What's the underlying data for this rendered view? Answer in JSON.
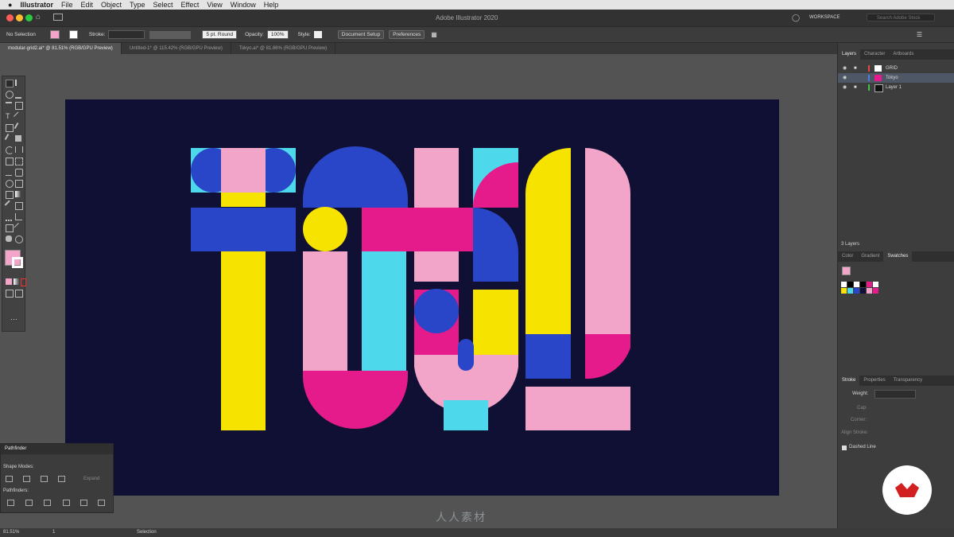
{
  "menubar": {
    "app": "Illustrator",
    "items": [
      "File",
      "Edit",
      "Object",
      "Type",
      "Select",
      "Effect",
      "View",
      "Window",
      "Help"
    ]
  },
  "appbar": {
    "title": "Adobe Illustrator 2020",
    "workspace": "WORKSPACE",
    "search_placeholder": "Search Adobe Stock"
  },
  "controlbar": {
    "selection": "No Selection",
    "stroke_label": "Stroke:",
    "brush": "5 pt. Round",
    "opacity_label": "Opacity:",
    "opacity": "100%",
    "style_label": "Style:",
    "document_setup": "Document Setup",
    "preferences": "Preferences"
  },
  "tabs": [
    {
      "label": "modular-grid2.ai* @ 81.51% (RGB/GPU Preview)",
      "active": true
    },
    {
      "label": "Untitled-1* @ 115.42% (RGB/GPU Preview)",
      "active": false
    },
    {
      "label": "Tokyo.ai* @ 81.86% (RGB/GPU Preview)",
      "active": false
    }
  ],
  "layers_panel": {
    "tabs": [
      "Layers",
      "Character",
      "Artboards"
    ],
    "layers": [
      {
        "name": "GRID",
        "color": "#e64747"
      },
      {
        "name": "Tokyo",
        "color": "#4a7de0"
      },
      {
        "name": "Layer 1",
        "color": "#3fc34a"
      }
    ],
    "count": "3 Layers"
  },
  "swatches_panel": {
    "tabs": [
      "Color",
      "Gradient",
      "Swatches"
    ],
    "colors": [
      "#ffffff",
      "#000000",
      "#ffffff",
      "#000000",
      "#e51b8b",
      "#ffffff",
      "#f7e300",
      "#4ed8ec",
      "#2a46c8",
      "#101035",
      "#f2a5c9",
      "#e51b8b"
    ]
  },
  "stroke_panel": {
    "tabs": [
      "Stroke",
      "Properties",
      "Transparency"
    ],
    "weight_label": "Weight:",
    "cap_label": "Cap:",
    "corner_label": "Corner:",
    "align_label": "Align Stroke:",
    "dashed": "Dashed Line"
  },
  "pathfinder": {
    "title": "Pathfinder",
    "shape_modes": "Shape Modes:",
    "expand": "Expand",
    "pathfinders": "Pathfinders:"
  },
  "statusbar": {
    "zoom": "81.51%",
    "page": "1",
    "mode": "Selection"
  },
  "watermark": "人人素材",
  "colors": {
    "navy": "#101035",
    "pink": "#f2a5c9",
    "magenta": "#e51b8b",
    "blue": "#2a46c8",
    "cyan": "#4ed8ec",
    "yellow": "#f7e300"
  }
}
